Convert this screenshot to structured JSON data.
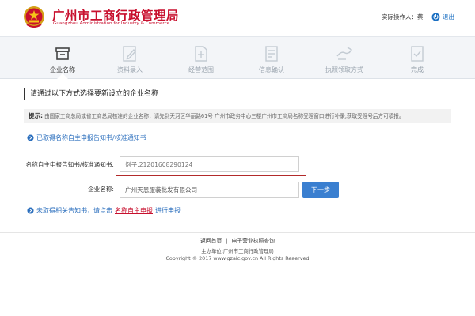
{
  "header": {
    "org_name_cn": "广州市工商行政管理局",
    "org_name_en": "Guangzhou Administration for Industry & Commerce",
    "operator_label": "实际操作人：蔡",
    "logout_label": "退出"
  },
  "steps": [
    {
      "label": "企业名称",
      "icon": "archive-box-icon",
      "active": true
    },
    {
      "label": "资料录入",
      "icon": "edit-document-icon",
      "active": false
    },
    {
      "label": "经营范围",
      "icon": "add-document-icon",
      "active": false
    },
    {
      "label": "信息确认",
      "icon": "checklist-icon",
      "active": false
    },
    {
      "label": "执照领取方式",
      "icon": "delivery-icon",
      "active": false
    },
    {
      "label": "完成",
      "icon": "check-document-icon",
      "active": false
    }
  ],
  "main": {
    "section_title": "请通过以下方式选择要新设立的企业名称",
    "tip_label": "提示:",
    "tip_text": "由国家工商总局或省工商总局核准的企业名称，请先到天河区华丽路61号 广州市政务中心三楼广州市工商局名称受理窗口进行补录,获取受理号后方可填报。",
    "option1_text": "已取得名称自主申报告知书/核准通知书",
    "notice_label": "名称自主申报告知书/核准通知书:",
    "notice_placeholder": "例子:21201608290124",
    "company_label": "企业名称:",
    "company_value": "广州天恩服装批发有限公司",
    "next_label": "下一步",
    "option2_prefix": "未取得相关告知书，请点击",
    "option2_link": "名称自主申报",
    "option2_suffix": "进行申报"
  },
  "footer": {
    "home_link": "返回首页",
    "license_link": "电子营业执照查询",
    "org_line": "主办单位:广州市工商行政管理局",
    "copyright": "Copyright © 2017 www.gzaic.gov.cn All Rights Reaerved"
  },
  "colors": {
    "brand_red": "#c8102e",
    "link_blue": "#2a6ebd",
    "button_blue": "#3a7fd0",
    "highlight_border": "#b22a2a"
  }
}
